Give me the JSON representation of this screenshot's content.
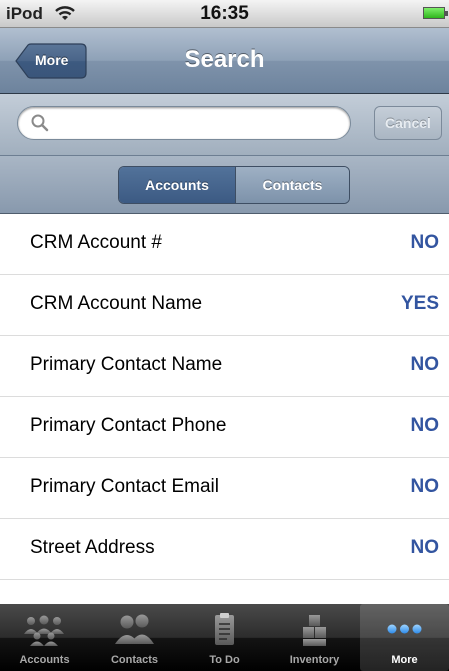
{
  "status_bar": {
    "carrier": "iPod",
    "time": "16:35"
  },
  "nav": {
    "back_label": "More",
    "title": "Search"
  },
  "search": {
    "placeholder": "",
    "value": "",
    "cancel_label": "Cancel"
  },
  "scope": {
    "options": [
      "Accounts",
      "Contacts"
    ],
    "selected": "Accounts"
  },
  "fields": [
    {
      "label": "CRM Account #",
      "value": "NO"
    },
    {
      "label": "CRM Account Name",
      "value": "YES"
    },
    {
      "label": "Primary Contact Name",
      "value": "NO"
    },
    {
      "label": "Primary Contact Phone",
      "value": "NO"
    },
    {
      "label": "Primary Contact Email",
      "value": "NO"
    },
    {
      "label": "Street Address",
      "value": "NO"
    },
    {
      "label": "",
      "value": ""
    }
  ],
  "tabs": [
    {
      "label": "Accounts",
      "icon": "accounts-icon"
    },
    {
      "label": "Contacts",
      "icon": "contacts-icon"
    },
    {
      "label": "To Do",
      "icon": "todo-icon"
    },
    {
      "label": "Inventory",
      "icon": "inventory-icon"
    },
    {
      "label": "More",
      "icon": "more-icon"
    }
  ],
  "selected_tab": "More",
  "colors": {
    "nav_blue": "#7f93ab",
    "value_blue": "#3355a0",
    "tab_bg": "#000000"
  }
}
